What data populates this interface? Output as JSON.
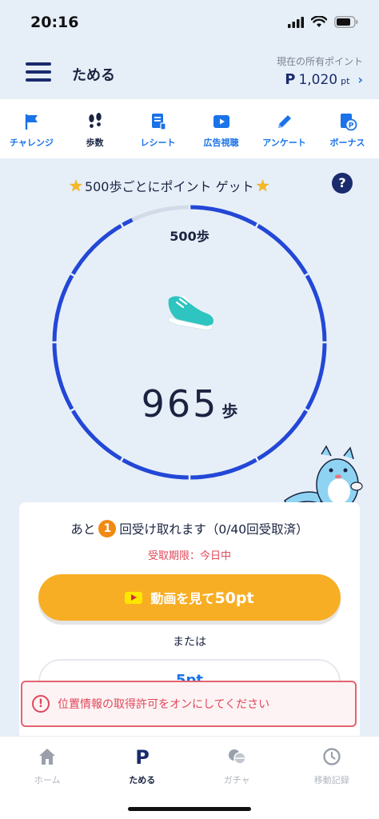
{
  "status_bar": {
    "time": "20:16"
  },
  "header": {
    "title": "ためる",
    "points_label": "現在の所有ポイント",
    "points_glyph": "P",
    "points_value": "1,020",
    "points_unit": "pt"
  },
  "tabs": [
    {
      "label": "チャレンジ",
      "icon": "flag-icon"
    },
    {
      "label": "歩数",
      "icon": "footprints-icon",
      "active": true
    },
    {
      "label": "レシート",
      "icon": "receipt-icon"
    },
    {
      "label": "広告視聴",
      "icon": "play-icon"
    },
    {
      "label": "アンケート",
      "icon": "pencil-icon"
    },
    {
      "label": "ボーナス",
      "icon": "bonus-icon"
    }
  ],
  "steps_section": {
    "heading": "500歩ごとにポイント ゲット",
    "goal_label": "500歩",
    "steps_value": "965",
    "steps_unit": "歩",
    "progress": 0.93
  },
  "reward_card": {
    "remaining_prefix": "あと",
    "remaining_count": "1",
    "remaining_suffix": "回受け取れます（0/40回受取済）",
    "deadline": "受取期限：今日中",
    "cta_label": "動画を見て",
    "cta_points": "50pt",
    "or_text": "または",
    "alt_button": "5pt"
  },
  "alert": {
    "text": "位置情報の取得許可をオンにしてください"
  },
  "bottom_nav": [
    {
      "label": "ホーム",
      "icon": "home-icon"
    },
    {
      "label": "ためる",
      "icon": "p-logo-icon",
      "active": true
    },
    {
      "label": "ガチャ",
      "icon": "gacha-icon"
    },
    {
      "label": "移動記録",
      "icon": "clock-icon"
    }
  ],
  "colors": {
    "brand_navy": "#1a2b6d",
    "accent_blue": "#1a73e8",
    "ring_blue": "#2347d6",
    "cta_orange": "#f8ae24",
    "alert_red": "#e0475a",
    "background": "#e6eff8"
  }
}
